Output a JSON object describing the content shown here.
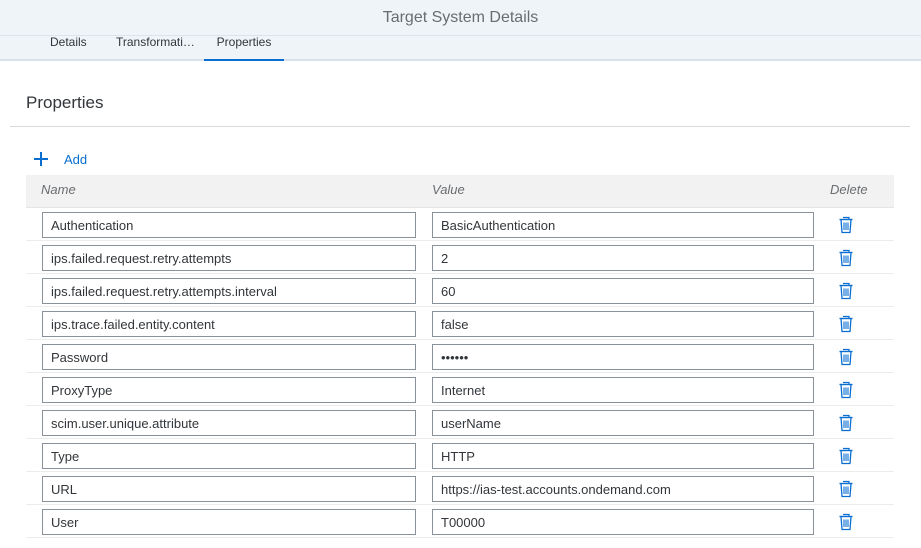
{
  "header": {
    "title": "Target System Details"
  },
  "tabs": [
    {
      "label": "Details"
    },
    {
      "label": "Transformations"
    },
    {
      "label": "Properties"
    }
  ],
  "section": {
    "title": "Properties",
    "add_label": "Add"
  },
  "table": {
    "columns": {
      "name": "Name",
      "value": "Value",
      "delete": "Delete"
    },
    "rows": [
      {
        "name": "Authentication",
        "value": "BasicAuthentication"
      },
      {
        "name": "ips.failed.request.retry.attempts",
        "value": "2"
      },
      {
        "name": "ips.failed.request.retry.attempts.interval",
        "value": "60"
      },
      {
        "name": "ips.trace.failed.entity.content",
        "value": "false"
      },
      {
        "name": "Password",
        "value": "••••••"
      },
      {
        "name": "ProxyType",
        "value": "Internet"
      },
      {
        "name": "scim.user.unique.attribute",
        "value": "userName"
      },
      {
        "name": "Type",
        "value": "HTTP"
      },
      {
        "name": "URL",
        "value": "https://ias-test.accounts.ondemand.com"
      },
      {
        "name": "User",
        "value": "T00000"
      }
    ]
  },
  "colors": {
    "accent": "#0a6ed1",
    "header_bg": "#eff4f9"
  },
  "icons": {
    "add": "plus-icon",
    "delete": "trash-icon"
  }
}
